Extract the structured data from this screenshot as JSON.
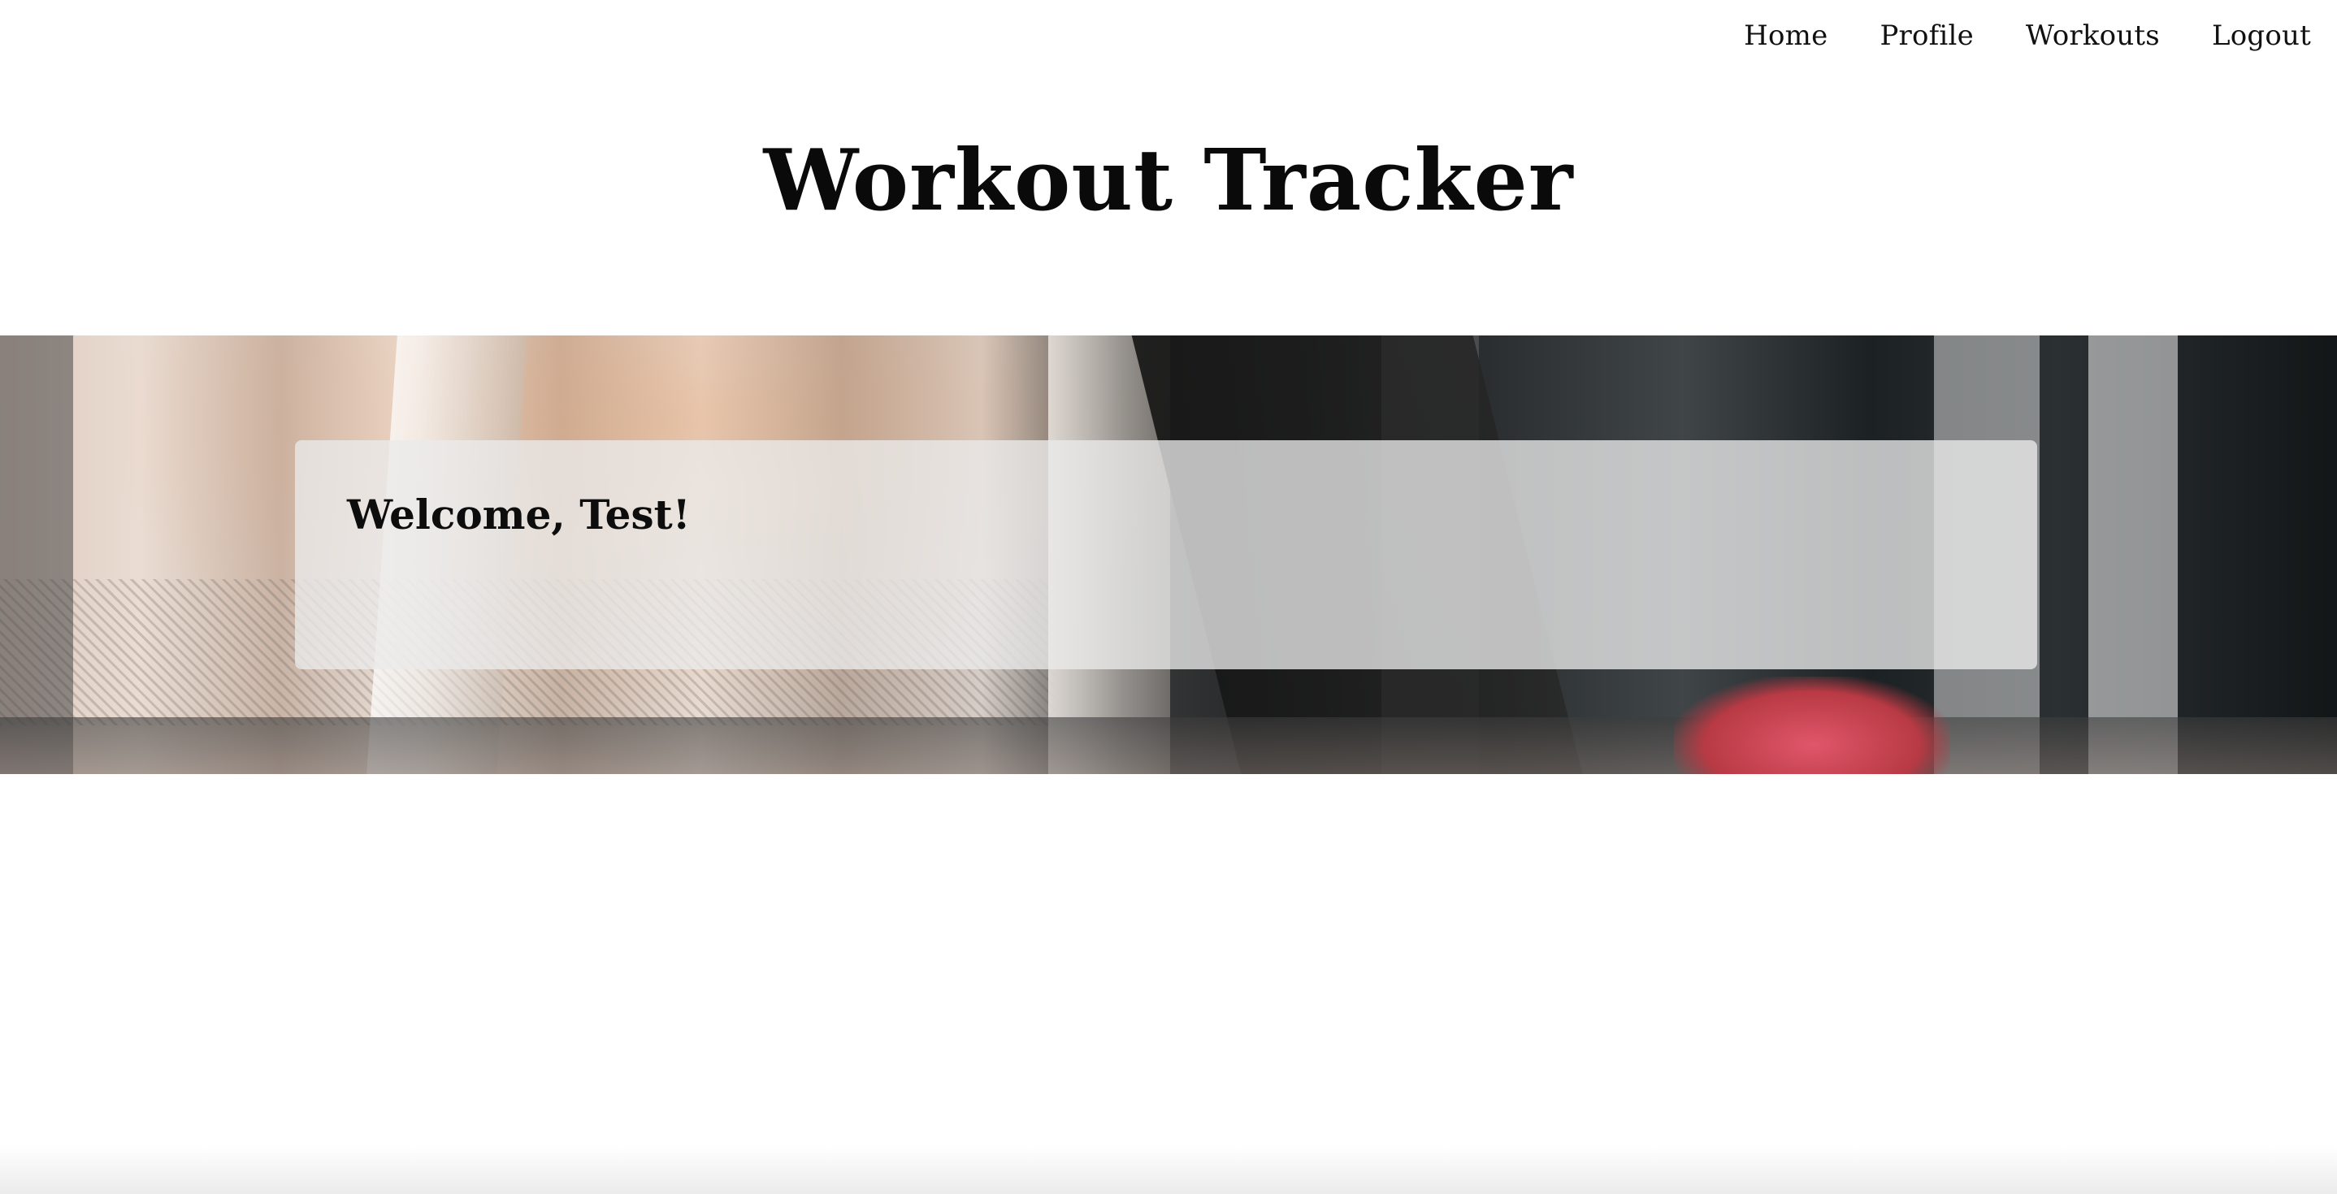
{
  "nav": {
    "items": [
      {
        "label": "Home"
      },
      {
        "label": "Profile"
      },
      {
        "label": "Workouts"
      },
      {
        "label": "Logout"
      }
    ]
  },
  "header": {
    "title": "Workout Tracker"
  },
  "hero": {
    "image_description": "gym-runner-photo",
    "welcome_text": "Welcome, Test!"
  }
}
